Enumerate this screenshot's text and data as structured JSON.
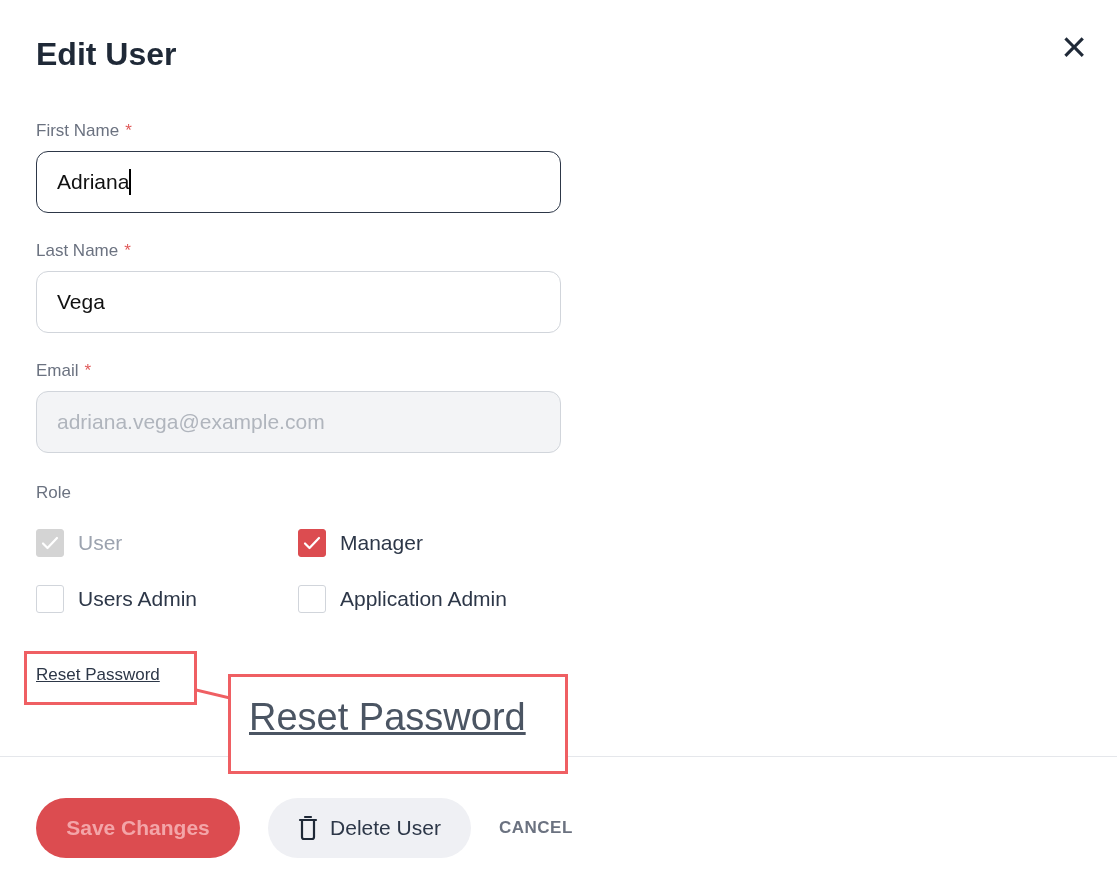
{
  "dialog": {
    "title": "Edit User",
    "close_icon": "×"
  },
  "fields": [
    {
      "label": "First Name",
      "required_mark": "*",
      "value": "Adriana",
      "focused": true,
      "disabled": false
    },
    {
      "label": "Last Name",
      "required_mark": "*",
      "value": "Vega",
      "focused": false,
      "disabled": false
    },
    {
      "label": "Email",
      "required_mark": "*",
      "value": "adriana.vega@example.com",
      "focused": false,
      "disabled": true
    }
  ],
  "role": {
    "label": "Role",
    "options": [
      {
        "label": "User",
        "checked": true,
        "disabled": true
      },
      {
        "label": "Manager",
        "checked": true,
        "disabled": false
      },
      {
        "label": "Users Admin",
        "checked": false
      },
      {
        "label": "Application Admin",
        "checked": false
      }
    ]
  },
  "reset_link": "Reset Password",
  "callout": {
    "text": "Reset Password"
  },
  "buttons": {
    "save": {
      "label": "Save Changes",
      "disabled": true
    },
    "delete": {
      "label": "Delete User"
    },
    "cancel": {
      "label": "CANCEL"
    }
  }
}
